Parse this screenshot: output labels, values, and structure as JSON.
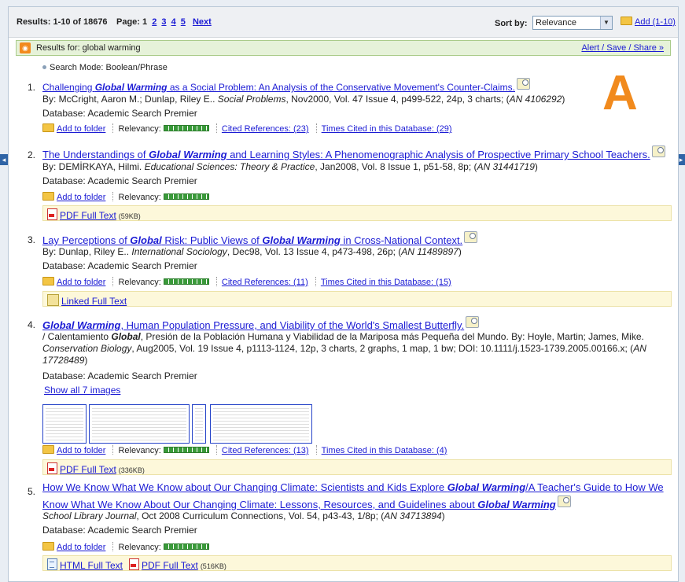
{
  "colors": {
    "link": "#1b1bd4",
    "accent": "#f18a1d",
    "relevancy": "#3a9a3a",
    "fulltext_bg": "#fdf8da"
  },
  "topbar": {
    "results_label": "Results: 1-10 of 18676",
    "page_label": "Page: 1",
    "pages": [
      "2",
      "3",
      "4",
      "5"
    ],
    "next": "Next",
    "sort_label": "Sort by:",
    "sort_value": "Relevance",
    "add_label": "Add (1-10)"
  },
  "results_for": {
    "label": "Results for: global warming",
    "alert": "Alert / Save / Share »"
  },
  "search_mode": "Search Mode: Boolean/Phrase",
  "logo_letter": "A",
  "common": {
    "add_to_folder": "Add to folder",
    "relevancy": "Relevancy:",
    "database": "Database: Academic Search Premier"
  },
  "records": [
    {
      "num": "1.",
      "title_pre": "Challenging ",
      "hl1": "Global Warming",
      "title_mid": " as a Social Problem: An Analysis of the Conservative Movement's Counter-Claims.",
      "by": "By: McCright, Aaron M.; Dunlap, Riley E.. ",
      "journal": "Social Problems",
      "rest": ", Nov2000, Vol. 47 Issue 4, p499-522, 24p, 3 charts; (",
      "an": "AN 4106292",
      "close": ")",
      "cited": "Cited References: (23)",
      "times": "Times Cited in this Database: (29)"
    },
    {
      "num": "2.",
      "title_pre": "The Understandings of ",
      "hl1": "Global Warming",
      "title_mid": " and Learning Styles: A Phenomenographic Analysis of Prospective Primary School Teachers.",
      "by": "By: DEMİRKAYA, Hilmi. ",
      "journal": "Educational Sciences: Theory & Practice",
      "rest": ", Jan2008, Vol. 8 Issue 1, p51-58, 8p; (",
      "an": "AN 31441719",
      "close": ")",
      "pdf": "PDF Full Text",
      "pdf_size": "(59KB)"
    },
    {
      "num": "3.",
      "t1": "Lay Perceptions of ",
      "h1": "Global",
      "t2": " Risk: Public Views of ",
      "h2": "Global Warming",
      "t3": " in Cross-National Context.",
      "by": "By: Dunlap, Riley E.. ",
      "journal": "International Sociology",
      "rest": ", Dec98, Vol. 13 Issue 4, p473-498, 26p; (",
      "an": "AN 11489897",
      "close": ")",
      "cited": "Cited References: (11)",
      "times": "Times Cited in this Database: (15)",
      "linked": "Linked Full Text"
    },
    {
      "num": "4.",
      "h1": "Global Warming",
      "t1": ", Human Population Pressure, and Viability of the World's Smallest Butterfly.",
      "alt_pre": "/ Calentamiento ",
      "alt_hl": "Global",
      "alt_rest": ", Presión de la Población Humana y Viabilidad de la Mariposa más Pequeña del Mundo. By: Hoyle, Martin; James, Mike.",
      "journal": "Conservation Biology",
      "rest": ", Aug2005, Vol. 19 Issue 4, p1113-1124, 12p, 3 charts, 2 graphs, 1 map, 1 bw; DOI: 10.1111/j.1523-1739.2005.00166.x; (",
      "an1": "AN",
      "an2": "17728489",
      "close": ")",
      "images": "Show all 7 images",
      "cited": "Cited References: (13)",
      "times": "Times Cited in this Database: (4)",
      "pdf": "PDF Full Text",
      "pdf_size": "(336KB)"
    },
    {
      "num": "5.",
      "t1": "How We Know What We Know about Our Changing Climate: Scientists and Kids Explore ",
      "h1": "Global Warming",
      "t2": "/A Teacher's Guide to How We",
      "t3": "Know What We Know About Our Changing Climate: Lessons, Resources, and Guidelines about ",
      "h2": "Global Warming",
      ".": ".",
      "journal": "School Library Journal",
      "rest": ", Oct 2008 Curriculum Connections, Vol. 54, p43-43, 1/8p; (",
      "an": "AN 34713894",
      "close": ")",
      "html": "HTML Full Text",
      "pdf": "PDF Full Text",
      "pdf_size": "(516KB)"
    }
  ]
}
